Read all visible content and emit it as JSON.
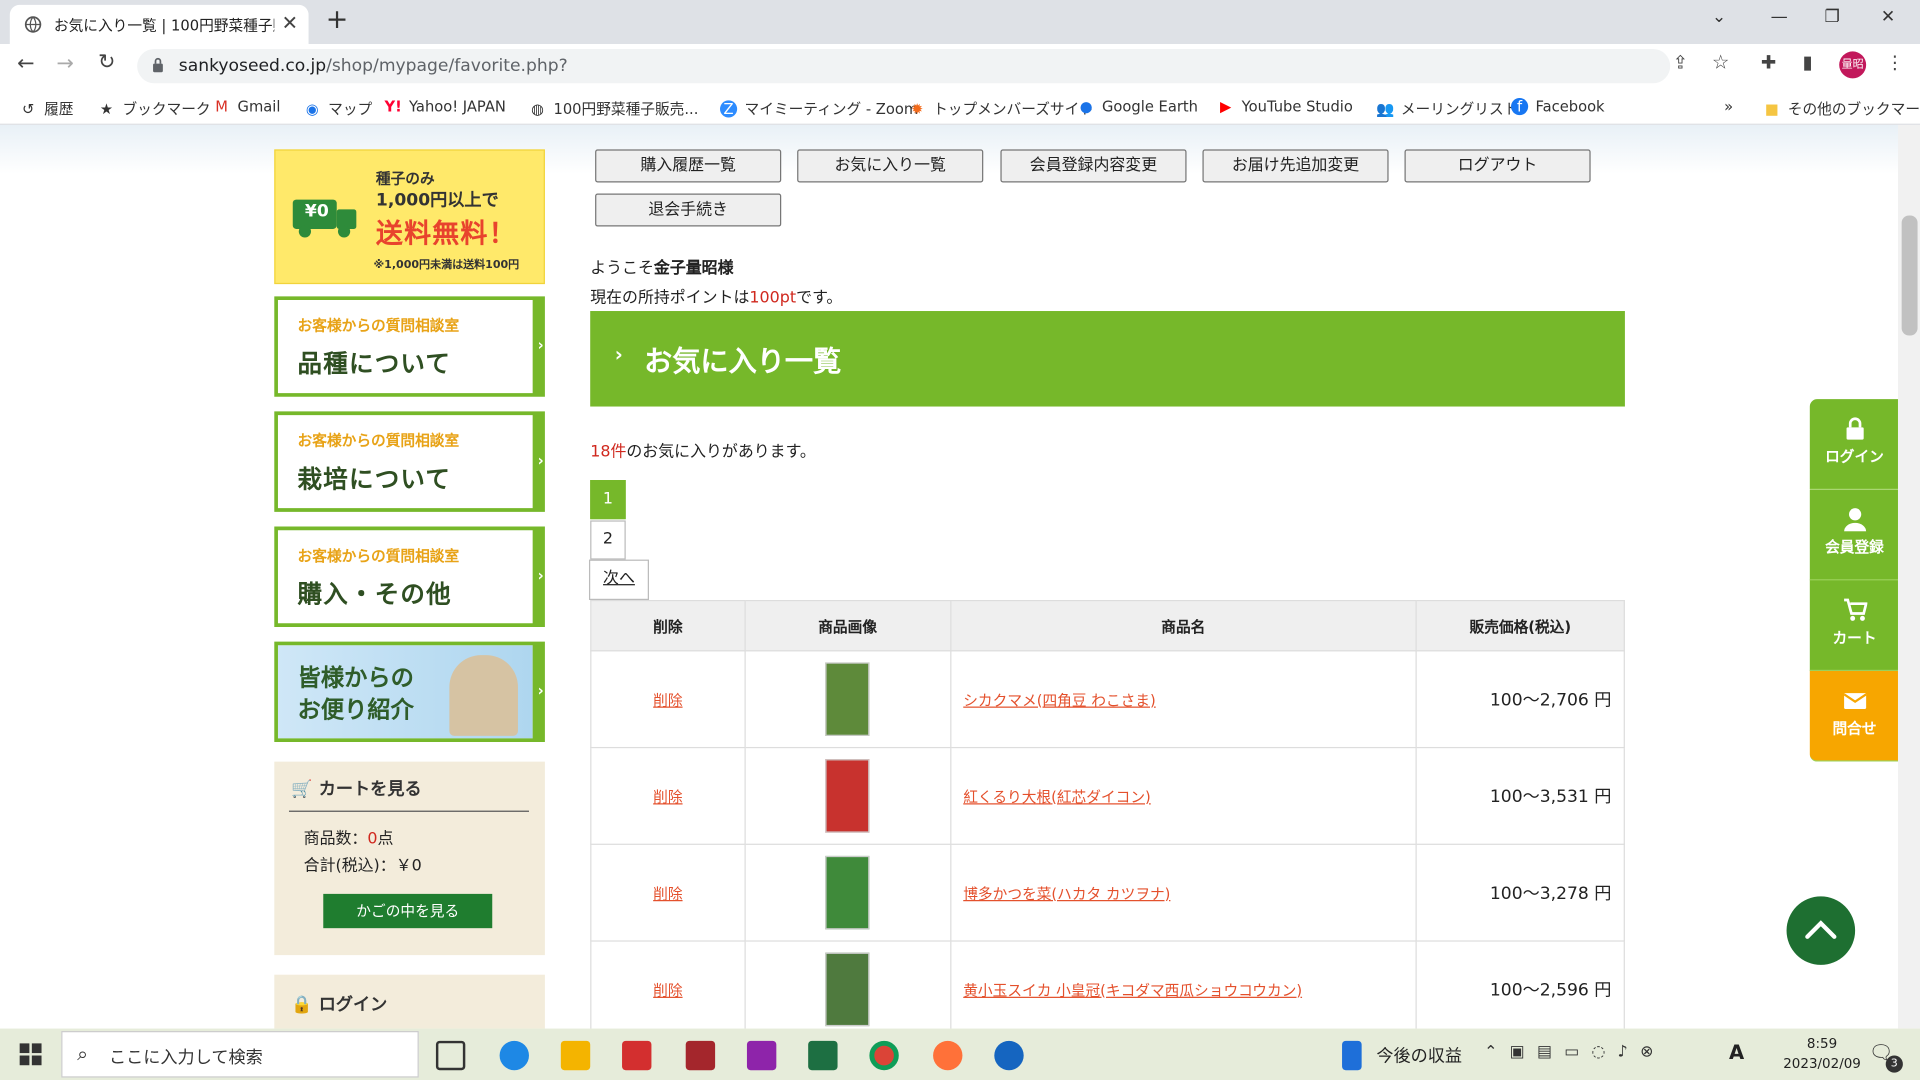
{
  "browser": {
    "tab_title": "お気に入り一覧 | 100円野菜種子販",
    "url_host": "sankyoseed.co.jp",
    "url_path": "/shop/mypage/favorite.php?",
    "bookmarks": [
      "履歴",
      "ブックマーク",
      "Gmail",
      "マップ",
      "Yahoo! JAPAN",
      "100円野菜種子販売...",
      "マイミーティング - Zoom",
      "トップメンバーズサイト",
      "Google Earth",
      "YouTube Studio",
      "メーリングリスト",
      "Facebook"
    ],
    "other_bookmarks": "その他のブックマーク",
    "profile_label": "量昭"
  },
  "sidebar": {
    "promo": {
      "line1": "種子のみ",
      "line2": "1,000円以上で",
      "line3": "送料無料！",
      "note": "※1,000円未満は送料100円",
      "badge": "¥0"
    },
    "questions": [
      {
        "small": "お客様からの質問相談室",
        "big": "品種について"
      },
      {
        "small": "お客様からの質問相談室",
        "big": "栽培について"
      },
      {
        "small": "お客様からの質問相談室",
        "big": "購入・その他"
      }
    ],
    "otayori": {
      "line1": "皆様からの",
      "line2": "お便り紹介"
    },
    "cart": {
      "title": "カートを見る",
      "items_label": "商品数：",
      "items_value": "0",
      "items_unit": "点",
      "total_label": "合計(税込)：",
      "total_value": "￥0",
      "button": "かごの中を見る"
    },
    "login_title": "ログイン"
  },
  "mypage_nav": [
    "購入履歴一覧",
    "お気に入り一覧",
    "会員登録内容変更",
    "お届け先追加変更",
    "ログアウト",
    "退会手続き"
  ],
  "welcome": {
    "prefix": "ようこそ",
    "name": "金子量昭様"
  },
  "points": {
    "prefix": "現在の所持ポイントは",
    "value": "100pt",
    "suffix": "です。"
  },
  "heading": "お気に入り一覧",
  "count": {
    "value": "18件",
    "suffix": "のお気に入りがあります。"
  },
  "pagination": {
    "p1": "1",
    "p2": "2",
    "next": "次へ"
  },
  "table": {
    "headers": [
      "削除",
      "商品画像",
      "商品名",
      "販売価格(税込)"
    ],
    "rows": [
      {
        "del": "削除",
        "name": "シカクマメ(四角豆 わこさま)",
        "price": "100～2,706 円",
        "color": "#5e8a3a"
      },
      {
        "del": "削除",
        "name": "紅くるり大根(紅芯ダイコン)",
        "price": "100～3,531 円",
        "color": "#c8322e"
      },
      {
        "del": "削除",
        "name": "博多かつを菜(ハカタ カツヲナ)",
        "price": "100～3,278 円",
        "color": "#3f8a3a"
      },
      {
        "del": "削除",
        "name": "黄小玉スイカ 小皇冠(キコダマ西瓜ショウコウカン)",
        "price": "100～2,596 円",
        "color": "#4f7a3e"
      }
    ]
  },
  "float_menu": [
    "ログイン",
    "会員登録",
    "カート",
    "問合せ"
  ],
  "taskbar": {
    "search_placeholder": "ここに入力して検索",
    "widget": "今後の収益",
    "time": "8:59",
    "date": "2023/02/09",
    "notif": "3"
  }
}
